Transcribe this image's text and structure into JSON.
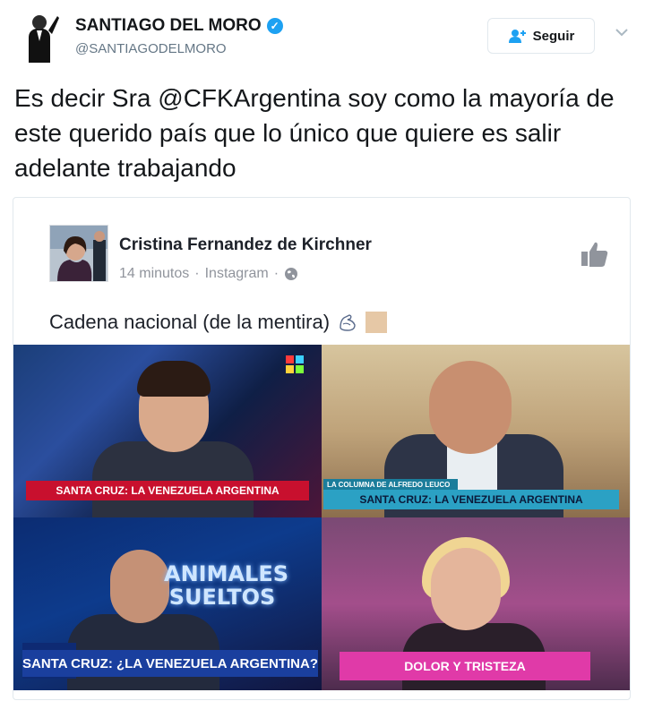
{
  "tweet": {
    "author_name": "SANTIAGO DEL MORO",
    "author_handle": "@SANTIAGODELMORO",
    "follow_label": "Seguir",
    "text": "Es decir Sra @CFKArgentina soy como la mayoría de este querido país que lo único que quiere es salir adelante trabajando"
  },
  "embed": {
    "post_author": "Cristina Fernandez de Kirchner",
    "post_time": "14 minutos",
    "post_source": "Instagram",
    "separator": "·",
    "post_text": "Cadena nacional (de la mentira)"
  },
  "photos": {
    "panel1_chyron": "SANTA CRUZ: LA VENEZUELA ARGENTINA",
    "panel2_chyron": "SANTA CRUZ: LA VENEZUELA ARGENTINA",
    "panel2_subtitle": "LA COLUMNA DE ALFREDO LEUCO",
    "panel3_show": "ANIMALES SUELTOS",
    "panel3_chyron": "SANTA CRUZ: ¿LA VENEZUELA ARGENTINA?",
    "panel4_chyron": "DOLOR Y TRISTEZA"
  },
  "colors": {
    "verified": "#1da1f2",
    "handle": "#657786",
    "chyron_red": "#c8102e",
    "chyron_pink": "#e03aa8"
  }
}
